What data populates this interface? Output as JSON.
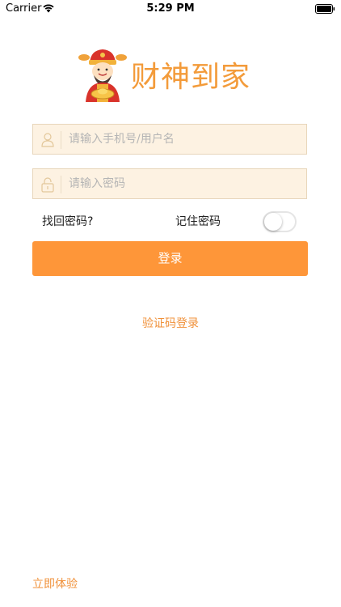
{
  "status_bar": {
    "carrier": "Carrier",
    "time": "5:29 PM"
  },
  "logo": {
    "text": "财神到家",
    "color": "#f39b3a"
  },
  "form": {
    "username_placeholder": "请输入手机号/用户名",
    "password_placeholder": "请输入密码",
    "forgot_password": "找回密码?",
    "remember_password": "记住密码",
    "remember_on": false,
    "login_label": "登录"
  },
  "links": {
    "sms_login": "验证码登录",
    "try_now": "立即体验"
  },
  "colors": {
    "accent": "#fe9639",
    "field_bg": "#fdf2e2",
    "link": "#f0913a"
  },
  "icons": {
    "username": "user-icon",
    "password": "lock-icon",
    "wifi": "wifi-icon",
    "battery": "battery-icon"
  }
}
